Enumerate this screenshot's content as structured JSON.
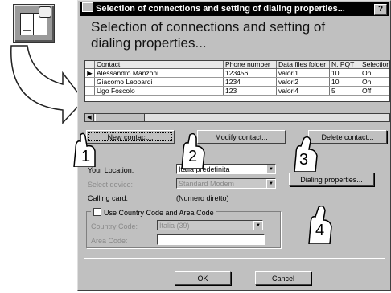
{
  "dialog": {
    "title": "Selection of connections and setting of dialing properties...",
    "help_label": "?",
    "heading": "Selection of connections and setting of dialing properties..."
  },
  "table": {
    "columns": [
      "Contact",
      "Phone number",
      "Data files folder",
      "N. PQT",
      "Selection"
    ],
    "rows": [
      {
        "marker": "▶",
        "contact": "Alessandro Manzoni",
        "phone": "123456",
        "folder": "valori1",
        "npqt": "10",
        "selection": "On"
      },
      {
        "marker": "",
        "contact": "Giacomo Leopardi",
        "phone": "1234",
        "folder": "valori2",
        "npqt": "10",
        "selection": "On"
      },
      {
        "marker": "",
        "contact": "Ugo Foscolo",
        "phone": "123",
        "folder": "valori4",
        "npqt": "5",
        "selection": "Off"
      }
    ]
  },
  "buttons": {
    "new_contact": "New contact...",
    "modify_contact": "Modify contact...",
    "delete_contact": "Delete contact...",
    "dialing_properties": "Dialing properties...",
    "ok": "OK",
    "cancel": "Cancel"
  },
  "form": {
    "location_label": "Your Location:",
    "location_value": "Italia predefinita",
    "device_label": "Select device:",
    "device_value": "Standard Modem",
    "calling_card_label": "Calling card:",
    "calling_card_value": "(Numero diretto)",
    "use_country_code_label": "Use Country Code and Area Code",
    "country_code_label": "Country Code:",
    "country_code_value": "Italia (39)",
    "area_code_label": "Area Code:",
    "area_code_value": ""
  },
  "callouts": [
    "1",
    "2",
    "3",
    "4"
  ]
}
